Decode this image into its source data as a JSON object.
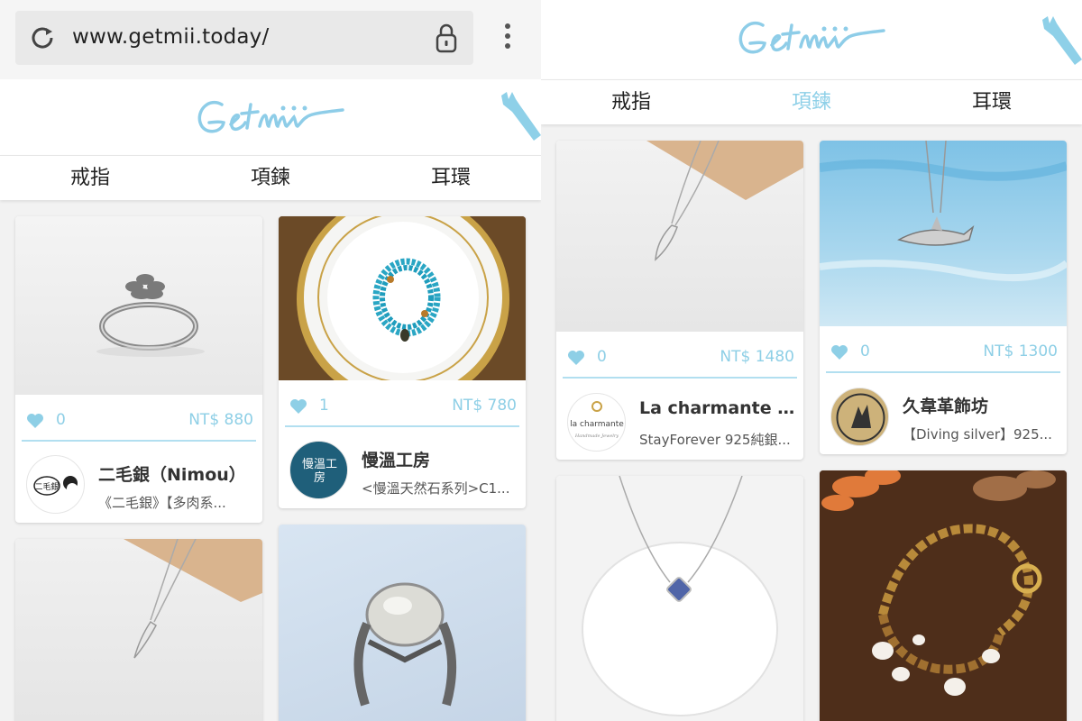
{
  "browser": {
    "url": "www.getmii.today/",
    "reload_icon": "reload-icon",
    "lock_icon": "lock-icon",
    "menu_icon": "overflow-menu-icon"
  },
  "site": {
    "logo_text": "Getmii",
    "brand_color": "#8ed0e8",
    "nav": [
      "戒指",
      "項鍊",
      "耳環"
    ],
    "active_tab_right": "項鍊"
  },
  "left_cards": [
    {
      "likes": "0",
      "price": "NT$ 880",
      "shop_name": "二毛銀（Nimou）",
      "item_name": "《二毛銀》【多肉系...",
      "shop_logo_text": "二毛銀"
    },
    {
      "likes": "1",
      "price": "NT$ 780",
      "shop_name": "慢溫工房",
      "item_name": "<慢溫天然石系列>C1...",
      "shop_logo_text": "慢溫工房"
    }
  ],
  "right_cards": [
    {
      "likes": "0",
      "price": "NT$ 1480",
      "shop_name": "La charmante Je...",
      "item_name": "StayForever 925純銀...",
      "shop_logo_text": "la charmante",
      "shop_logo_sub": "Handmade Jewelry"
    },
    {
      "likes": "0",
      "price": "NT$ 1300",
      "shop_name": "久韋革飾坊",
      "item_name": "【Diving silver】925...",
      "shop_logo_text": ""
    }
  ]
}
